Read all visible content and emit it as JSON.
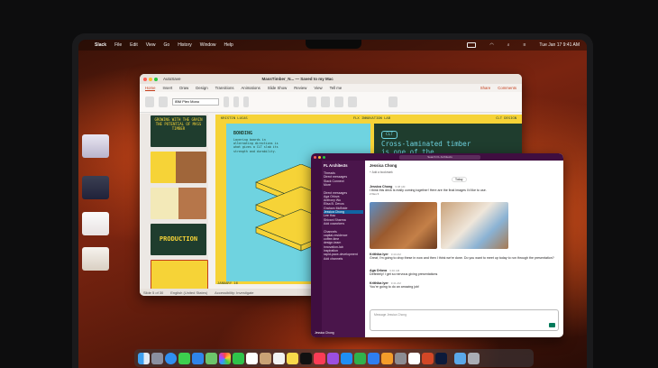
{
  "menubar": {
    "app": "Slack",
    "items": [
      "File",
      "Edit",
      "View",
      "Go",
      "History",
      "Window",
      "Help"
    ],
    "clock": "Tue Jan 17  9:41 AM"
  },
  "ppt": {
    "autosave": "AutoSave",
    "title": "MassTimber_N... — Saved to my Mac",
    "tabs": [
      "Home",
      "Insert",
      "Draw",
      "Design",
      "Transitions",
      "Animations",
      "Slide Show",
      "Review",
      "View",
      "Tell me"
    ],
    "share": "Share",
    "comments": "Comments",
    "font": "IBM Plex Mono",
    "slide_header": [
      "KRISTIN LUCAS",
      "FLX INNOVATION LAB",
      "CLT DESIGN"
    ],
    "slide_bonding": "BONDING",
    "slide_body": "Layering boards in alternating directions is what gives a CLT slab its strength and durability.",
    "slide_clt": "CLT",
    "slide_headline": "Cross-laminated timber is one of the strongest and most",
    "thumb1": "GROWING WITH THE GRAIN THE POTENTIAL OF MASS TIMBER",
    "thumb_production": "PRODUCTION",
    "thumb_date": "JANUARY 16",
    "status": [
      "Slide 5 of 30",
      "English (United States)",
      "Accessibility: Investigate"
    ]
  },
  "slack": {
    "search": "Search FL Architects",
    "workspace": "FL Architects",
    "sidebar": [
      "Threads",
      "Direct messages",
      "Slack Connect",
      "More",
      "",
      "Direct messages",
      "Aga Orlova",
      "Anthony Wu",
      "Elisa B. Devos",
      "Graham McBride",
      "Jessica Chong",
      "Lee Hao",
      "Shivani Sharma",
      "Add coworkers",
      "",
      "Channels",
      "capital-residence",
      "coffee-time",
      "design-team",
      "innovation-lab",
      "inspiration",
      "rapid-pace-development",
      "Add channels"
    ],
    "dm_name": "Jessica Chong",
    "add_bookmark": "+ Add a bookmark",
    "day": "Today",
    "msgs": [
      {
        "name": "Jessica Chong",
        "time": "9:38 AM",
        "text": "I think this deck is really coming together! Here are the final images I'd like to use."
      },
      {
        "name": "Krithika Iyer",
        "time": "9:40 AM",
        "text": "Great, I'm going to drop these in now and then I think we're done. Do you want to meet up today to run through the presentation?"
      },
      {
        "name": "Aga Orlova",
        "time": "9:40 AM",
        "text": "Definitely! I get so nervous giving presentations"
      },
      {
        "name": "Krithika Iyer",
        "time": "9:41 AM",
        "text": "You're going to do an amazing job!"
      }
    ],
    "files_label": "2 files ▾",
    "composer": "Message Jessica Chong",
    "footer_user": "Jessica Chong"
  },
  "colors": {
    "ppt_accent": "#c43e1c",
    "slide_yellow": "#f6d337",
    "slide_green": "#1f3d2e",
    "slide_sky": "#6fd3e0",
    "slack_purple": "#4a154b",
    "slack_selected": "#1164a3"
  }
}
